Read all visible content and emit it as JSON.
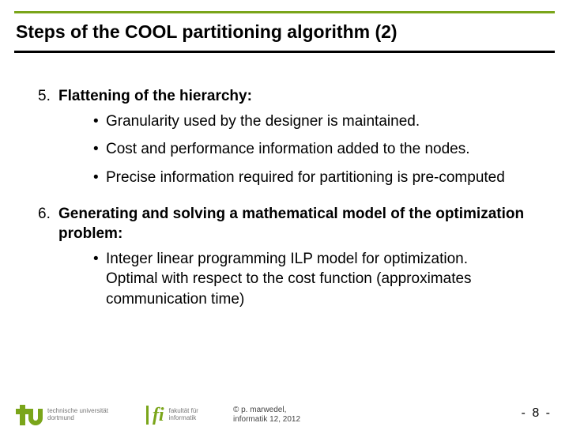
{
  "title": "Steps of the COOL partitioning algorithm (2)",
  "items": [
    {
      "num": "5.",
      "heading": "Flattening of the hierarchy:",
      "bullets": [
        "Granularity used by the designer is maintained.",
        "Cost and performance information added to the nodes.",
        "Precise information required for partitioning is pre-computed"
      ]
    },
    {
      "num": "6.",
      "heading": "Generating and solving a mathematical model of the optimization problem:",
      "bullets": [
        "Integer linear programming ILP model for optimization. Optimal with respect to the cost function (approximates communication time)"
      ]
    }
  ],
  "footer": {
    "tu_line1": "technische universität",
    "tu_line2": "dortmund",
    "fi_line1": "fakultät für",
    "fi_line2": "informatik",
    "fi_mark": "fi",
    "copy_line1": "© p. marwedel,",
    "copy_line2": "informatik 12,  2012",
    "page": "-  8 -"
  },
  "bullet_mark": "•"
}
